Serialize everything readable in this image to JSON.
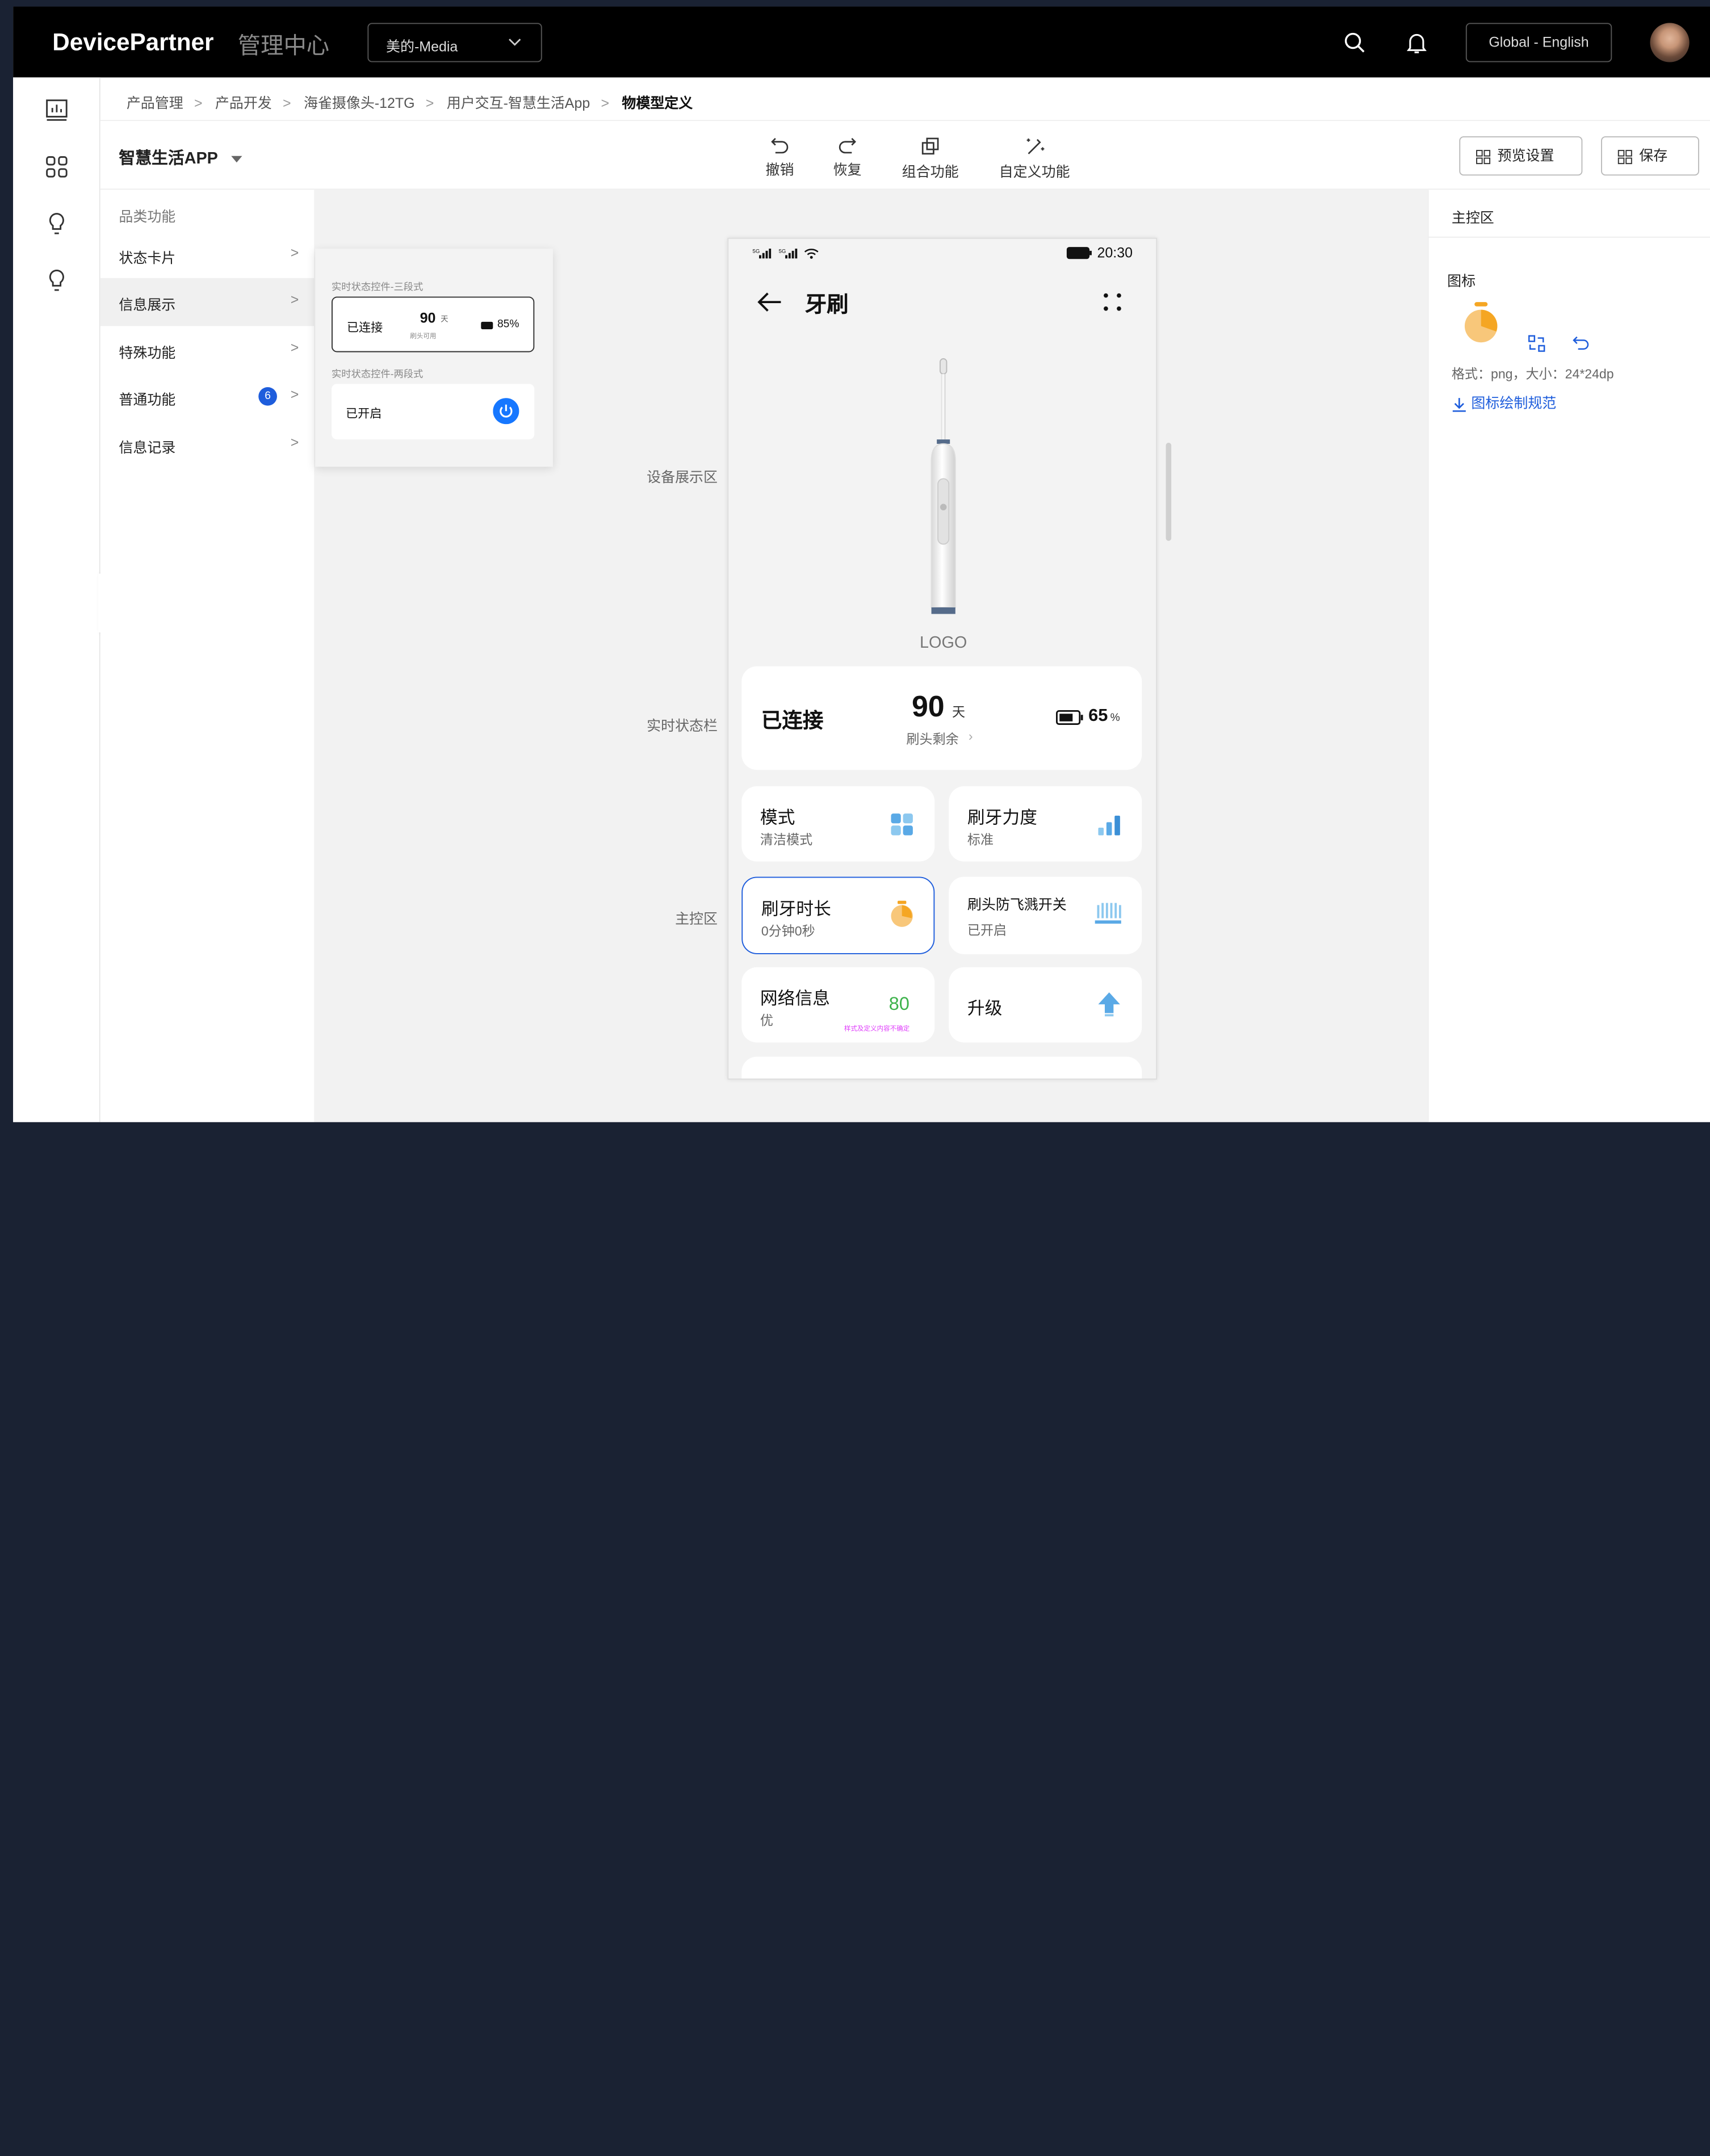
{
  "header": {
    "brand": "DevicePartner",
    "subtitle": "管理中心",
    "tenant": "美的-Media",
    "language": "Global - English"
  },
  "breadcrumb": [
    "产品管理",
    "产品开发",
    "海雀摄像头-12TG",
    "用户交互-智慧生活App",
    "物模型定义"
  ],
  "toolbar": {
    "app_select": "智慧生活APP",
    "undo": "撤销",
    "redo": "恢复",
    "combine": "组合功能",
    "custom": "自定义功能",
    "preview": "预览设置",
    "save": "保存"
  },
  "left_panel": {
    "header": "品类功能",
    "items": [
      {
        "label": "状态卡片"
      },
      {
        "label": "信息展示"
      },
      {
        "label": "特殊功能"
      },
      {
        "label": "普通功能",
        "badge": "6"
      },
      {
        "label": "信息记录"
      }
    ]
  },
  "flyout": {
    "three_label": "实时状态控件-三段式",
    "three_connected": "已连接",
    "three_days": "90",
    "three_unit": "天",
    "three_sub": "刷头可用",
    "three_battery": "85%",
    "two_label": "实时状态控件-两段式",
    "two_state": "已开启"
  },
  "zones": {
    "device": "设备展示区",
    "status": "实时状态栏",
    "main": "主控区"
  },
  "phone": {
    "time": "20:30",
    "title": "牙刷",
    "logo": "LOGO",
    "status": {
      "connected": "已连接",
      "days": "90",
      "days_unit": "天",
      "days_sub": "刷头剩余",
      "battery": "65",
      "battery_unit": "%"
    },
    "cards": [
      {
        "title": "模式",
        "sub": "清洁模式"
      },
      {
        "title": "刷牙力度",
        "sub": "标准"
      },
      {
        "title": "刷牙时长",
        "sub": "0分钟0秒"
      },
      {
        "title": "刷头防飞溅开关",
        "sub": "已开启"
      },
      {
        "title": "网络信息",
        "sub": "优",
        "value": "80",
        "note": "样式及定义内容不确定"
      },
      {
        "title": "升级"
      }
    ]
  },
  "right_panel": {
    "header": "主控区",
    "icon_label": "图标",
    "format": "格式：png，大小：24*24dp",
    "link": "图标绘制规范"
  },
  "colors": {
    "accent": "#1e5ddc",
    "orange": "#f5a623",
    "green": "#3db24b",
    "pink": "#e040fb"
  }
}
